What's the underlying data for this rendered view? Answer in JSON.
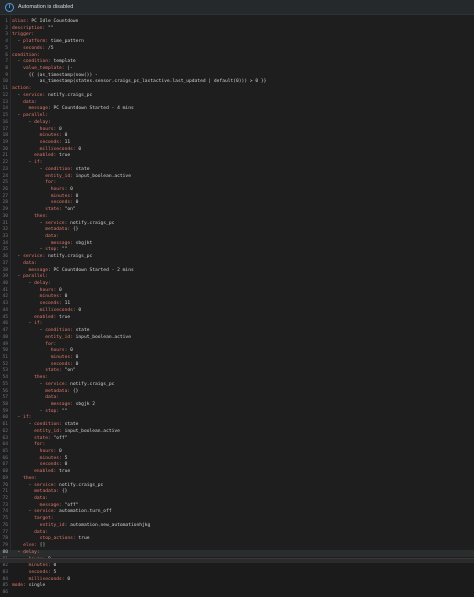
{
  "banner": {
    "icon": "info-icon",
    "text": "Automation is disabled"
  },
  "editor": {
    "active_line": 80,
    "lines": [
      [
        [
          "k",
          "alias:"
        ],
        [
          "s",
          " PC Idle Countdown"
        ]
      ],
      [
        [
          "k",
          "description:"
        ],
        [
          "s",
          " \"\""
        ]
      ],
      [
        [
          "k",
          "trigger:"
        ]
      ],
      [
        [
          "p",
          "  - "
        ],
        [
          "k",
          "platform:"
        ],
        [
          "s",
          " time_pattern"
        ]
      ],
      [
        [
          "p",
          "    "
        ],
        [
          "k",
          "seconds:"
        ],
        [
          "s",
          " /5"
        ]
      ],
      [
        [
          "k",
          "condition:"
        ]
      ],
      [
        [
          "p",
          "  - "
        ],
        [
          "k",
          "condition:"
        ],
        [
          "s",
          " template"
        ]
      ],
      [
        [
          "p",
          "    "
        ],
        [
          "k",
          "value_template:"
        ],
        [
          "s",
          " |-"
        ]
      ],
      [
        [
          "s",
          "      {{ (as_timestamp(now()) -"
        ]
      ],
      [
        [
          "s",
          "          as_timestamp(states.sensor.craigs_pc_lastactive.last_updated | default(0))) > 0 }}"
        ]
      ],
      [
        [
          "k",
          "action:"
        ]
      ],
      [
        [
          "p",
          "  - "
        ],
        [
          "k",
          "service:"
        ],
        [
          "s",
          " notify.craigs_pc"
        ]
      ],
      [
        [
          "p",
          "    "
        ],
        [
          "k",
          "data:"
        ]
      ],
      [
        [
          "p",
          "      "
        ],
        [
          "k",
          "message:"
        ],
        [
          "s",
          " PC Countdown Started - 4 mins"
        ]
      ],
      [
        [
          "p",
          "  - "
        ],
        [
          "k",
          "parallel:"
        ]
      ],
      [
        [
          "p",
          "      - "
        ],
        [
          "k",
          "delay:"
        ]
      ],
      [
        [
          "p",
          "          "
        ],
        [
          "k",
          "hours:"
        ],
        [
          "s",
          " 0"
        ]
      ],
      [
        [
          "p",
          "          "
        ],
        [
          "k",
          "minutes:"
        ],
        [
          "s",
          " 0"
        ]
      ],
      [
        [
          "p",
          "          "
        ],
        [
          "k",
          "seconds:"
        ],
        [
          "s",
          " 11"
        ]
      ],
      [
        [
          "p",
          "          "
        ],
        [
          "k",
          "milliseconds:"
        ],
        [
          "s",
          " 0"
        ]
      ],
      [
        [
          "p",
          "        "
        ],
        [
          "k",
          "enabled:"
        ],
        [
          "s",
          " true"
        ]
      ],
      [
        [
          "p",
          "      - "
        ],
        [
          "k",
          "if:"
        ]
      ],
      [
        [
          "p",
          "          - "
        ],
        [
          "k",
          "condition:"
        ],
        [
          "s",
          " state"
        ]
      ],
      [
        [
          "p",
          "            "
        ],
        [
          "k",
          "entity_id:"
        ],
        [
          "s",
          " input_boolean.active"
        ]
      ],
      [
        [
          "p",
          "            "
        ],
        [
          "k",
          "for:"
        ]
      ],
      [
        [
          "p",
          "              "
        ],
        [
          "k",
          "hours:"
        ],
        [
          "s",
          " 0"
        ]
      ],
      [
        [
          "p",
          "              "
        ],
        [
          "k",
          "minutes:"
        ],
        [
          "s",
          " 0"
        ]
      ],
      [
        [
          "p",
          "              "
        ],
        [
          "k",
          "seconds:"
        ],
        [
          "s",
          " 0"
        ]
      ],
      [
        [
          "p",
          "            "
        ],
        [
          "k",
          "state:"
        ],
        [
          "s",
          " \"on\""
        ]
      ],
      [
        [
          "p",
          "        "
        ],
        [
          "k",
          "then:"
        ]
      ],
      [
        [
          "p",
          "          - "
        ],
        [
          "k",
          "service:"
        ],
        [
          "s",
          " notify.craigs_pc"
        ]
      ],
      [
        [
          "p",
          "            "
        ],
        [
          "k",
          "metadata:"
        ],
        [
          "s",
          " {}"
        ]
      ],
      [
        [
          "p",
          "            "
        ],
        [
          "k",
          "data:"
        ]
      ],
      [
        [
          "p",
          "              "
        ],
        [
          "k",
          "message:"
        ],
        [
          "s",
          " sbgjkt"
        ]
      ],
      [
        [
          "p",
          "          - "
        ],
        [
          "k",
          "stop:"
        ],
        [
          "s",
          " \"\""
        ]
      ],
      [
        [
          "p",
          "  - "
        ],
        [
          "k",
          "service:"
        ],
        [
          "s",
          " notify.craigs_pc"
        ]
      ],
      [
        [
          "p",
          "    "
        ],
        [
          "k",
          "data:"
        ]
      ],
      [
        [
          "p",
          "      "
        ],
        [
          "k",
          "message:"
        ],
        [
          "s",
          " PC Countdown Started - 2 mins"
        ]
      ],
      [
        [
          "p",
          "  - "
        ],
        [
          "k",
          "parallel:"
        ]
      ],
      [
        [
          "p",
          "      - "
        ],
        [
          "k",
          "delay:"
        ]
      ],
      [
        [
          "p",
          "          "
        ],
        [
          "k",
          "hours:"
        ],
        [
          "s",
          " 0"
        ]
      ],
      [
        [
          "p",
          "          "
        ],
        [
          "k",
          "minutes:"
        ],
        [
          "s",
          " 0"
        ]
      ],
      [
        [
          "p",
          "          "
        ],
        [
          "k",
          "seconds:"
        ],
        [
          "s",
          " 11"
        ]
      ],
      [
        [
          "p",
          "          "
        ],
        [
          "k",
          "milliseconds:"
        ],
        [
          "s",
          " 0"
        ]
      ],
      [
        [
          "p",
          "        "
        ],
        [
          "k",
          "enabled:"
        ],
        [
          "s",
          " true"
        ]
      ],
      [
        [
          "p",
          "      - "
        ],
        [
          "k",
          "if:"
        ]
      ],
      [
        [
          "p",
          "          - "
        ],
        [
          "k",
          "condition:"
        ],
        [
          "s",
          " state"
        ]
      ],
      [
        [
          "p",
          "            "
        ],
        [
          "k",
          "entity_id:"
        ],
        [
          "s",
          " input_boolean.active"
        ]
      ],
      [
        [
          "p",
          "            "
        ],
        [
          "k",
          "for:"
        ]
      ],
      [
        [
          "p",
          "              "
        ],
        [
          "k",
          "hours:"
        ],
        [
          "s",
          " 0"
        ]
      ],
      [
        [
          "p",
          "              "
        ],
        [
          "k",
          "minutes:"
        ],
        [
          "s",
          " 0"
        ]
      ],
      [
        [
          "p",
          "              "
        ],
        [
          "k",
          "seconds:"
        ],
        [
          "s",
          " 0"
        ]
      ],
      [
        [
          "p",
          "            "
        ],
        [
          "k",
          "state:"
        ],
        [
          "s",
          " \"on\""
        ]
      ],
      [
        [
          "p",
          "        "
        ],
        [
          "k",
          "then:"
        ]
      ],
      [
        [
          "p",
          "          - "
        ],
        [
          "k",
          "service:"
        ],
        [
          "s",
          " notify.craigs_pc"
        ]
      ],
      [
        [
          "p",
          "            "
        ],
        [
          "k",
          "metadata:"
        ],
        [
          "s",
          " {}"
        ]
      ],
      [
        [
          "p",
          "            "
        ],
        [
          "k",
          "data:"
        ]
      ],
      [
        [
          "p",
          "              "
        ],
        [
          "k",
          "message:"
        ],
        [
          "s",
          " sbgjk 2"
        ]
      ],
      [
        [
          "p",
          "          - "
        ],
        [
          "k",
          "stop:"
        ],
        [
          "s",
          " \"\""
        ]
      ],
      [
        [
          "p",
          "  - "
        ],
        [
          "k",
          "if:"
        ]
      ],
      [
        [
          "p",
          "      - "
        ],
        [
          "k",
          "condition:"
        ],
        [
          "s",
          " state"
        ]
      ],
      [
        [
          "p",
          "        "
        ],
        [
          "k",
          "entity_id:"
        ],
        [
          "s",
          " input_boolean.active"
        ]
      ],
      [
        [
          "p",
          "        "
        ],
        [
          "k",
          "state:"
        ],
        [
          "s",
          " \"off\""
        ]
      ],
      [
        [
          "p",
          "        "
        ],
        [
          "k",
          "for:"
        ]
      ],
      [
        [
          "p",
          "          "
        ],
        [
          "k",
          "hours:"
        ],
        [
          "s",
          " 0"
        ]
      ],
      [
        [
          "p",
          "          "
        ],
        [
          "k",
          "minutes:"
        ],
        [
          "s",
          " 5"
        ]
      ],
      [
        [
          "p",
          "          "
        ],
        [
          "k",
          "seconds:"
        ],
        [
          "s",
          " 0"
        ]
      ],
      [
        [
          "p",
          "        "
        ],
        [
          "k",
          "enabled:"
        ],
        [
          "s",
          " true"
        ]
      ],
      [
        [
          "p",
          "    "
        ],
        [
          "k",
          "then:"
        ]
      ],
      [
        [
          "p",
          "      - "
        ],
        [
          "k",
          "service:"
        ],
        [
          "s",
          " notify.craigs_pc"
        ]
      ],
      [
        [
          "p",
          "        "
        ],
        [
          "k",
          "metadata:"
        ],
        [
          "s",
          " {}"
        ]
      ],
      [
        [
          "p",
          "        "
        ],
        [
          "k",
          "data:"
        ]
      ],
      [
        [
          "p",
          "          "
        ],
        [
          "k",
          "message:"
        ],
        [
          "s",
          " \"off\""
        ]
      ],
      [
        [
          "p",
          "      - "
        ],
        [
          "k",
          "service:"
        ],
        [
          "s",
          " automation.turn_off"
        ]
      ],
      [
        [
          "p",
          "        "
        ],
        [
          "k",
          "target:"
        ]
      ],
      [
        [
          "p",
          "          "
        ],
        [
          "k",
          "entity_id:"
        ],
        [
          "s",
          " automation.new_automationhjkg"
        ]
      ],
      [
        [
          "p",
          "        "
        ],
        [
          "k",
          "data:"
        ]
      ],
      [
        [
          "p",
          "          "
        ],
        [
          "k",
          "stop_actions:"
        ],
        [
          "s",
          " true"
        ]
      ],
      [
        [
          "p",
          "    "
        ],
        [
          "k",
          "else:"
        ],
        [
          "s",
          " []"
        ]
      ],
      [
        [
          "p",
          "  - "
        ],
        [
          "k",
          "delay:"
        ]
      ],
      [
        [
          "p",
          "      "
        ],
        [
          "k",
          "hours:"
        ],
        [
          "s",
          " 0"
        ]
      ],
      [
        [
          "p",
          "      "
        ],
        [
          "k",
          "minutes:"
        ],
        [
          "s",
          " 0"
        ]
      ],
      [
        [
          "p",
          "      "
        ],
        [
          "k",
          "seconds:"
        ],
        [
          "s",
          " 5"
        ]
      ],
      [
        [
          "p",
          "      "
        ],
        [
          "k",
          "milliseconds:"
        ],
        [
          "s",
          " 0"
        ]
      ],
      [
        [
          "k",
          "mode:"
        ],
        [
          "s",
          " single"
        ]
      ],
      [
        [
          "s",
          ""
        ]
      ]
    ]
  }
}
